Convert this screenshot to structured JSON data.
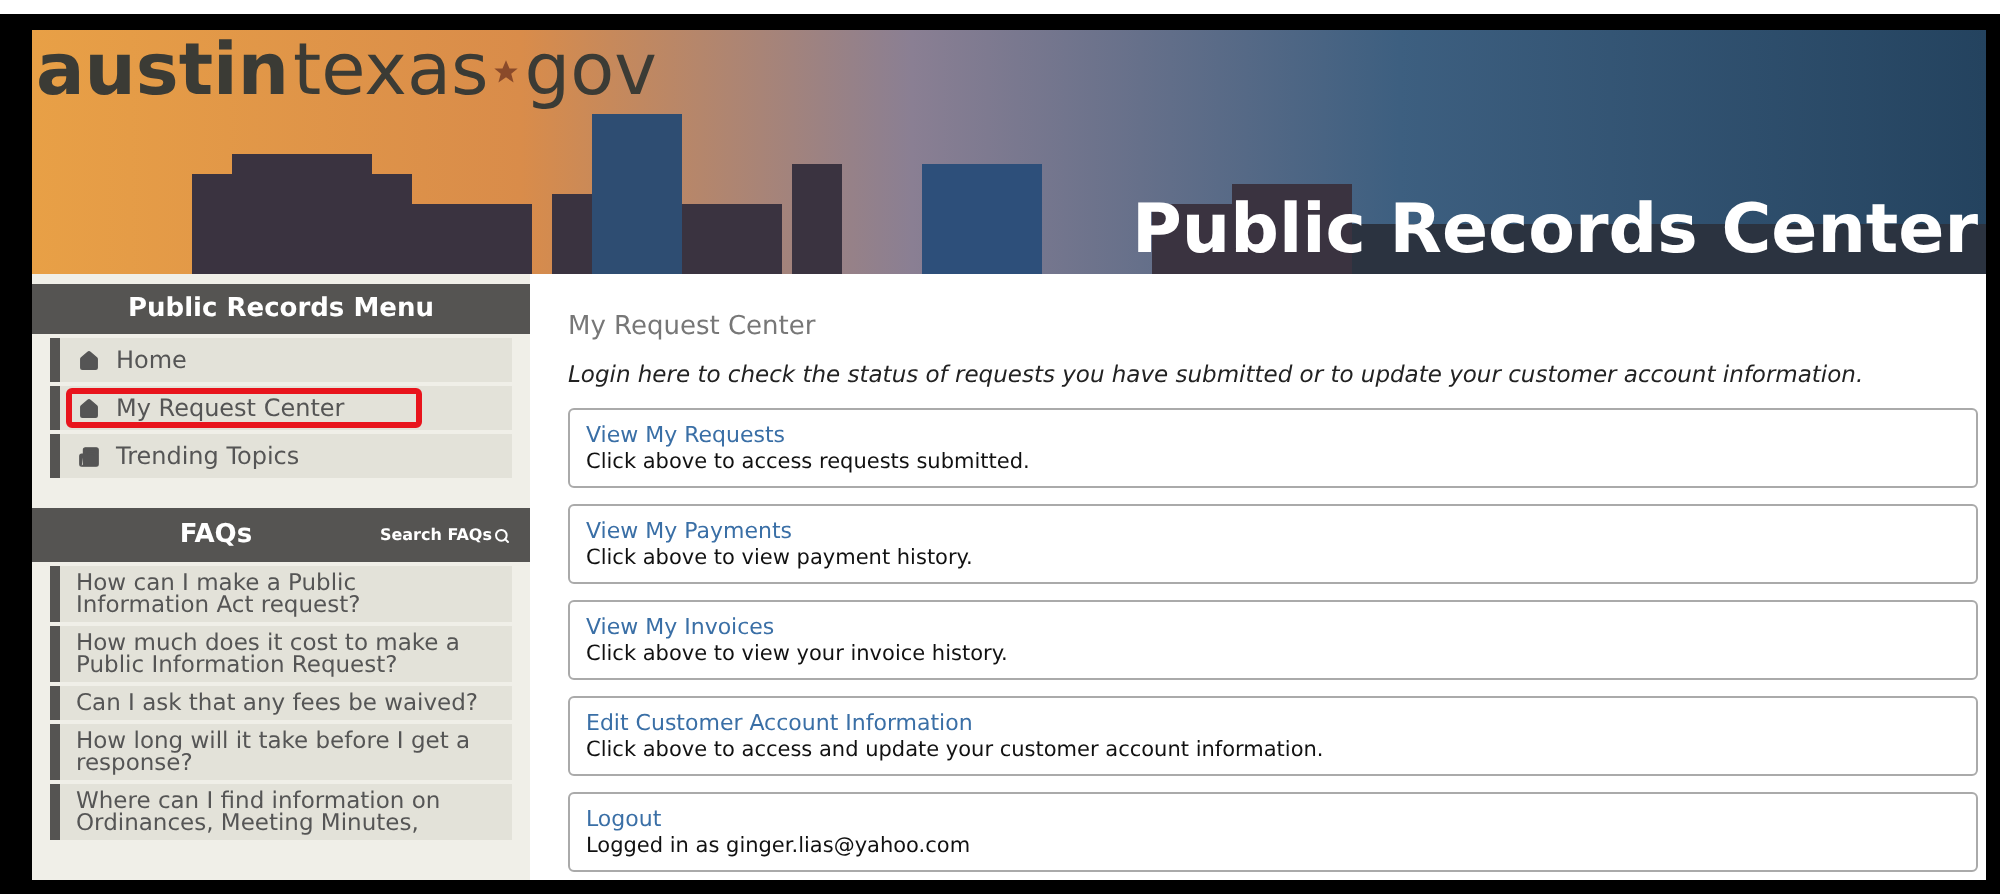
{
  "banner": {
    "logo": {
      "bold": "austin",
      "light": "texas",
      "suffix": "gov"
    },
    "title": "Public Records Center"
  },
  "menu": {
    "title": "Public Records Menu",
    "items": [
      {
        "label": "Home",
        "highlighted": false
      },
      {
        "label": "My Request Center",
        "highlighted": true
      },
      {
        "label": "Trending Topics",
        "highlighted": false
      }
    ]
  },
  "faqs": {
    "title": "FAQs",
    "search": "Search FAQs",
    "items": [
      "How can I make a Public Information Act request?",
      "How much does it cost to make a Public Information Request?",
      "Can I ask that any fees be waived?",
      "How long will it take before I get a response?",
      "Where can I find information on Ordinances, Meeting Minutes,"
    ]
  },
  "main": {
    "title": "My Request Center",
    "intro": "Login here to check the status of requests you have submitted or to update your customer account information.",
    "cards": [
      {
        "link": "View My Requests",
        "text": "Click above to access requests submitted."
      },
      {
        "link": "View My Payments",
        "text": "Click above to view payment history."
      },
      {
        "link": "View My Invoices",
        "text": "Click above to view your invoice history."
      },
      {
        "link": "Edit Customer Account Information",
        "text": "Click above to access and update your customer account information."
      },
      {
        "link": "Logout",
        "text": "Logged in as ginger.lias@yahoo.com"
      }
    ]
  }
}
